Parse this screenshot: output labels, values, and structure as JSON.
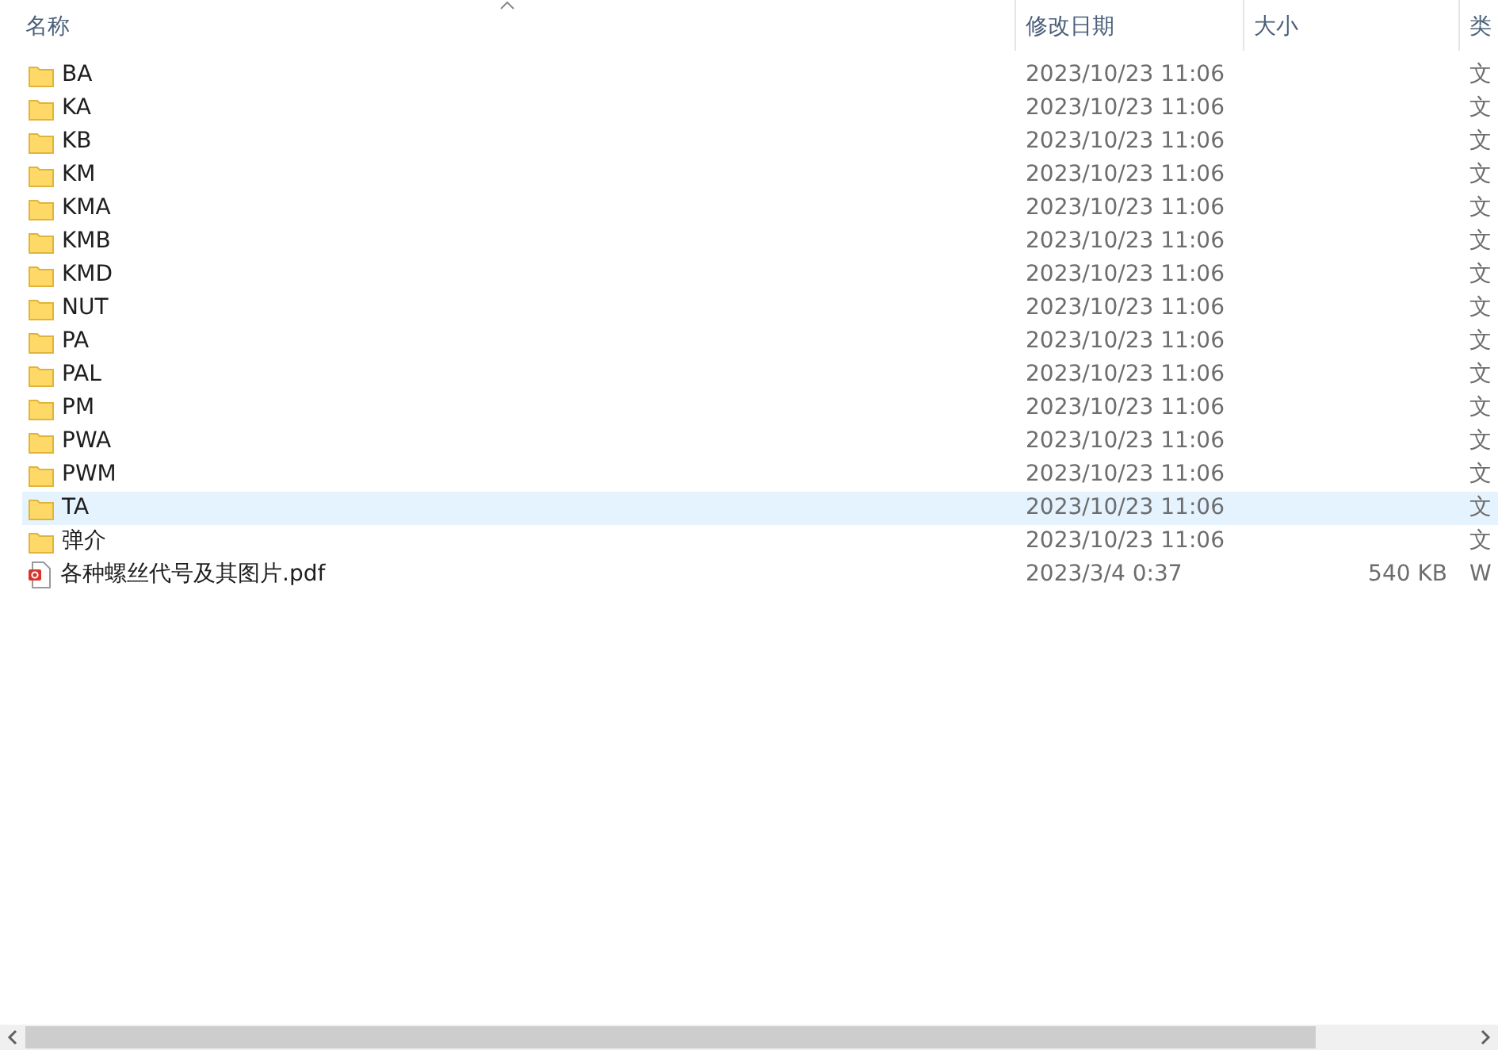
{
  "columns": [
    {
      "label": "名称",
      "sorted": true
    },
    {
      "label": "修改日期",
      "sorted": false
    },
    {
      "label": "大小",
      "sorted": false
    },
    {
      "label": "类",
      "sorted": false
    }
  ],
  "rows": [
    {
      "kind": "folder",
      "name": "BA",
      "modified": "2023/10/23 11:06",
      "type": "文",
      "selected": false
    },
    {
      "kind": "folder",
      "name": "KA",
      "modified": "2023/10/23 11:06",
      "type": "文",
      "selected": false
    },
    {
      "kind": "folder",
      "name": "KB",
      "modified": "2023/10/23 11:06",
      "type": "文",
      "selected": false
    },
    {
      "kind": "folder",
      "name": "KM",
      "modified": "2023/10/23 11:06",
      "type": "文",
      "selected": false
    },
    {
      "kind": "folder",
      "name": "KMA",
      "modified": "2023/10/23 11:06",
      "type": "文",
      "selected": false
    },
    {
      "kind": "folder",
      "name": "KMB",
      "modified": "2023/10/23 11:06",
      "type": "文",
      "selected": false
    },
    {
      "kind": "folder",
      "name": "KMD",
      "modified": "2023/10/23 11:06",
      "type": "文",
      "selected": false
    },
    {
      "kind": "folder",
      "name": "NUT",
      "modified": "2023/10/23 11:06",
      "type": "文",
      "selected": false
    },
    {
      "kind": "folder",
      "name": "PA",
      "modified": "2023/10/23 11:06",
      "type": "文",
      "selected": false
    },
    {
      "kind": "folder",
      "name": "PAL",
      "modified": "2023/10/23 11:06",
      "type": "文",
      "selected": false
    },
    {
      "kind": "folder",
      "name": "PM",
      "modified": "2023/10/23 11:06",
      "type": "文",
      "selected": false
    },
    {
      "kind": "folder",
      "name": "PWA",
      "modified": "2023/10/23 11:06",
      "type": "文",
      "selected": false
    },
    {
      "kind": "folder",
      "name": "PWM",
      "modified": "2023/10/23 11:06",
      "type": "文",
      "selected": false
    },
    {
      "kind": "folder",
      "name": "TA",
      "modified": "2023/10/23 11:06",
      "type": "文",
      "selected": true
    },
    {
      "kind": "folder",
      "name": "弹介",
      "modified": "2023/10/23 11:06",
      "type": "文",
      "selected": false
    },
    {
      "kind": "pdf",
      "name": "各种螺丝代号及其图片.pdf",
      "modified": "2023/3/4 0:37",
      "size": "540 KB",
      "type": "W",
      "selected": false
    }
  ]
}
